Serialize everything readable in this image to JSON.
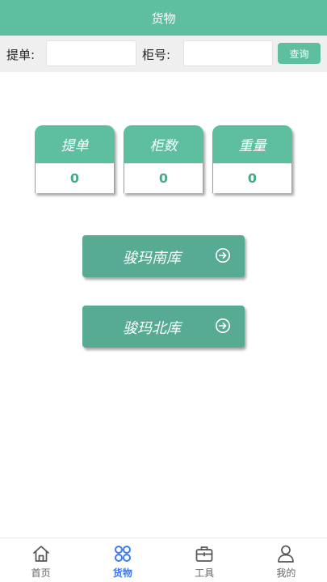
{
  "header": {
    "title": "货物"
  },
  "search": {
    "bill_label": "提单:",
    "bill_value": "",
    "container_label": "柜号:",
    "container_value": "",
    "query_label": "查询"
  },
  "stats": [
    {
      "label": "提单",
      "value": "0"
    },
    {
      "label": "柜数",
      "value": "0"
    },
    {
      "label": "重量",
      "value": "0"
    }
  ],
  "warehouses": [
    {
      "label": "骏玛南库",
      "icon": "arrow-circle-right-icon"
    },
    {
      "label": "骏玛北库",
      "icon": "arrow-circle-right-icon"
    }
  ],
  "tabbar": {
    "items": [
      {
        "label": "首页",
        "icon": "home-icon",
        "active": false
      },
      {
        "label": "货物",
        "icon": "grid-icon",
        "active": true
      },
      {
        "label": "工具",
        "icon": "briefcase-icon",
        "active": false
      },
      {
        "label": "我的",
        "icon": "user-icon",
        "active": false
      }
    ]
  },
  "colors": {
    "accent": "#5dbf9f",
    "button": "#56ab92",
    "active_tab": "#3a7bf0"
  }
}
